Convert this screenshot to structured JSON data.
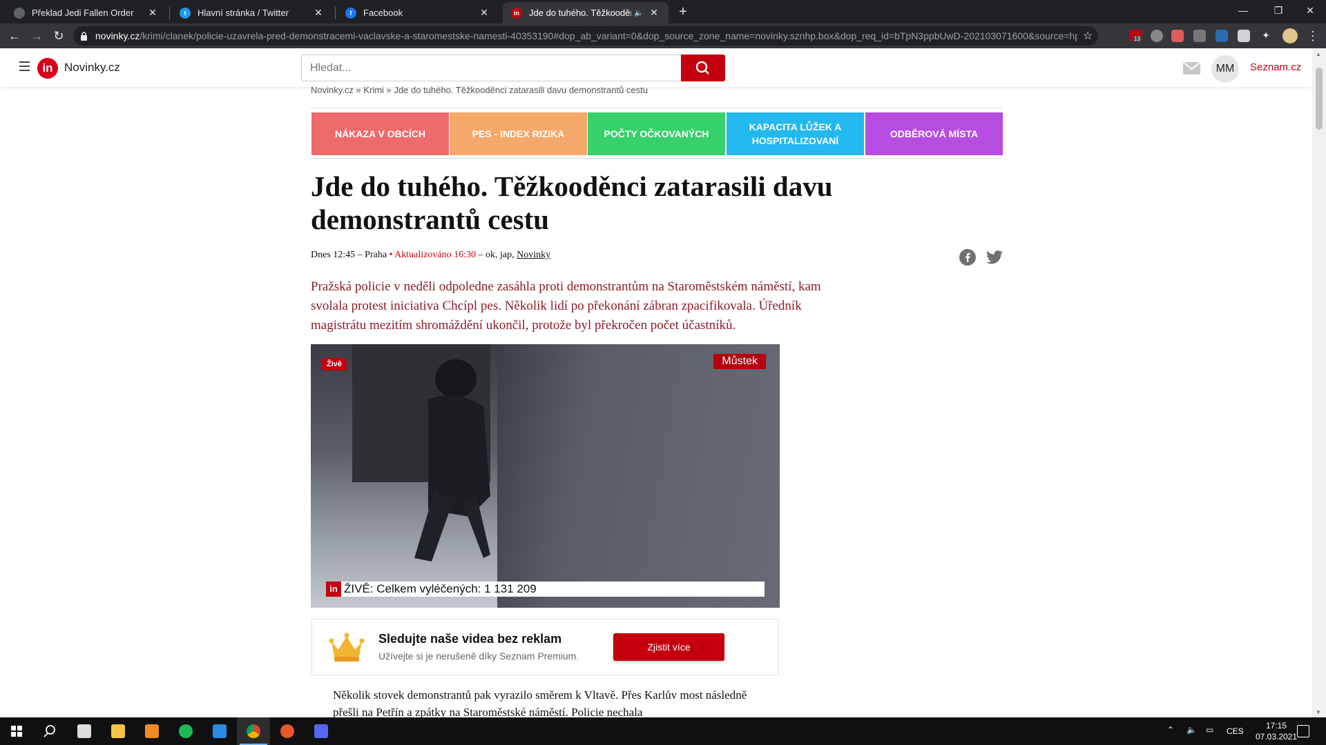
{
  "browser": {
    "tabs": [
      {
        "title": "Překlad Jedi Fallen Order",
        "icon": "globe-icon",
        "active": false
      },
      {
        "title": "Hlavní stránka / Twitter",
        "icon": "twitter-icon",
        "active": false
      },
      {
        "title": "Facebook",
        "icon": "facebook-icon",
        "active": false
      },
      {
        "title": "Jde do tuhého. Těžkooděnci",
        "icon": "novinky-icon",
        "active": true
      }
    ],
    "url_host": "novinky.cz",
    "url_path": "/krimi/clanek/policie-uzavrela-pred-demonstracemi-vaclavske-a-staromestske-namesti-40353190#dop_ab_variant=0&dop_source_zone_name=novinky.sznhp.box&dop_req_id=bTpN3ppbUwD-202103071600&source=hp...",
    "extension_badge": "13"
  },
  "site": {
    "logo_text": "in",
    "brand": "Novinky.cz",
    "search_placeholder": "Hledat...",
    "avatar_initials": "MM",
    "seznam_link": "Seznam.cz",
    "accent_color": "#c4000f"
  },
  "breadcrumb": "Novinky.cz » Krimi » Jde do tuhého. Těžkooděnci zatarasili davu demonstrantů cestu",
  "quick_links": [
    {
      "label": "NÁKAZA V OBCÍCH",
      "color": "#ef6b6b"
    },
    {
      "label": "PES - INDEX RIZIKA",
      "color": "#f4a96a"
    },
    {
      "label": "POČTY OČKOVANÝCH",
      "color": "#36d16a"
    },
    {
      "label": "KAPACITA LŮŽEK A HOSPITALIZOVANÍ",
      "color": "#23b8ee"
    },
    {
      "label": "ODBĚROVÁ MÍSTA",
      "color": "#b74de0"
    }
  ],
  "article": {
    "headline": "Jde do tuhého. Těžkooděnci zatarasili davu demonstrantů cestu",
    "byline_time": "Dnes 12:45 – Praha",
    "byline_updated": " • Aktualizováno 16:30",
    "byline_authors": " – ok, jap, ",
    "byline_source": "Novinky",
    "lead": "Pražská policie v neděli odpoledne zasáhla proti demonstrantům na Staroměstském náměstí, kam svolala protest iniciativa Chcípl pes. Několik lidí po překonání zábran zpacifikovala. Úředník magistrátu mezitím shromáždění ukončil, protože byl překročen počet účastníků.",
    "video": {
      "live_badge": "Živě",
      "location": "Můstek",
      "ticker_logo": "in",
      "ticker_text": "ŽIVĚ: Celkem vyléčených: 1 131 209"
    },
    "promo": {
      "title": "Sledujte naše videa bez reklam",
      "subtitle": "Užívejte si je nerušeně díky Seznam Premium.",
      "button": "Zjistit více"
    },
    "body_text": "Několik stovek demonstrantů pak vyrazilo směrem k Vltavě. Přes Karlův most následně přešli na Petřín a zpátky na Staroměstské náměstí. Policie nechala"
  },
  "taskbar": {
    "language": "CES",
    "time": "17:15",
    "date": "07.03.2021"
  }
}
